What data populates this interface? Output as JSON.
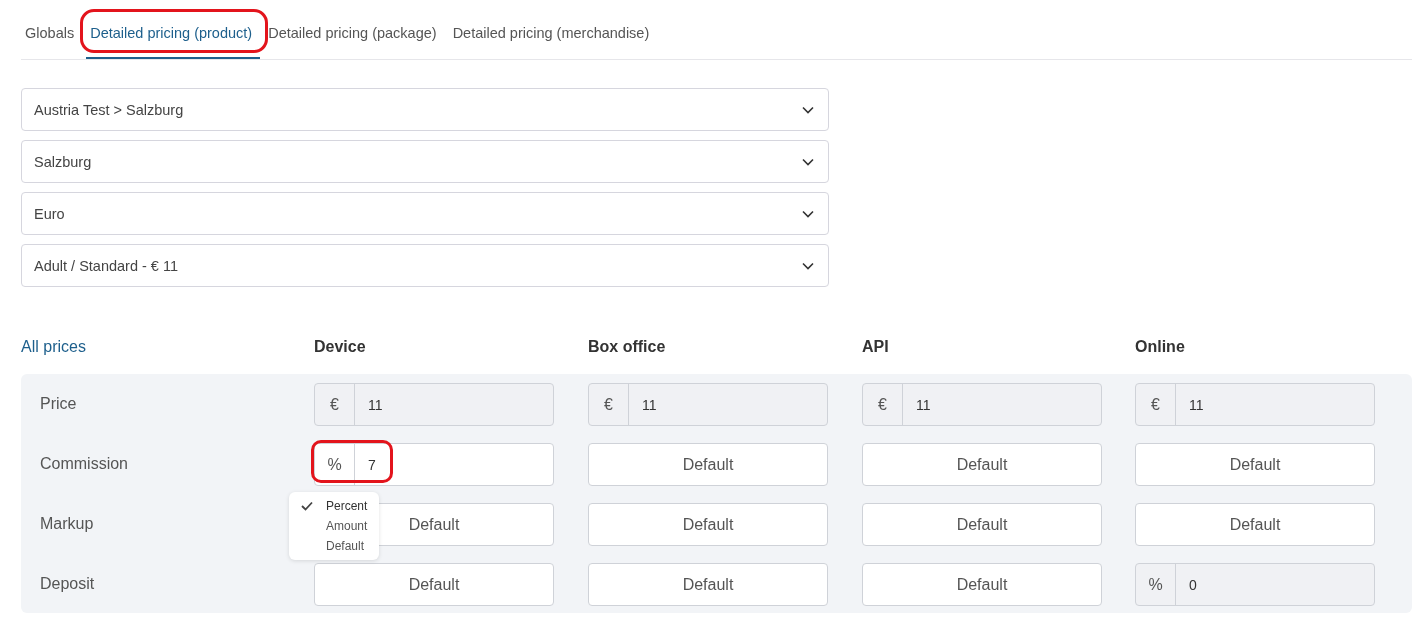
{
  "tabs": [
    {
      "label": "Globals",
      "selected": false,
      "highlighted": false
    },
    {
      "label": "Detailed pricing (product)",
      "selected": true,
      "highlighted": true
    },
    {
      "label": "Detailed pricing (package)",
      "selected": false,
      "highlighted": false
    },
    {
      "label": "Detailed pricing (merchandise)",
      "selected": false,
      "highlighted": false
    }
  ],
  "selects": [
    {
      "value": "Austria Test  > Salzburg"
    },
    {
      "value": "Salzburg"
    },
    {
      "value": "Euro"
    },
    {
      "value": "Adult / Standard - € 11"
    }
  ],
  "table": {
    "link": "All prices",
    "columns": [
      "Device",
      "Box office",
      "API",
      "Online"
    ],
    "rows": [
      {
        "label": "Price",
        "cells": [
          {
            "kind": "unit",
            "unit": "€",
            "value": "11",
            "disabled": true,
            "highlighted": false
          },
          {
            "kind": "unit",
            "unit": "€",
            "value": "11",
            "disabled": true,
            "highlighted": false
          },
          {
            "kind": "unit",
            "unit": "€",
            "value": "11",
            "disabled": true,
            "highlighted": false
          },
          {
            "kind": "unit",
            "unit": "€",
            "value": "11",
            "disabled": true,
            "highlighted": false
          }
        ]
      },
      {
        "label": "Commission",
        "cells": [
          {
            "kind": "unit",
            "unit": "%",
            "value": "7",
            "disabled": false,
            "highlighted": true
          },
          {
            "kind": "default",
            "label": "Default"
          },
          {
            "kind": "default",
            "label": "Default"
          },
          {
            "kind": "default",
            "label": "Default"
          }
        ]
      },
      {
        "label": "Markup",
        "cells": [
          {
            "kind": "default",
            "label": "Default"
          },
          {
            "kind": "default",
            "label": "Default"
          },
          {
            "kind": "default",
            "label": "Default"
          },
          {
            "kind": "default",
            "label": "Default"
          }
        ]
      },
      {
        "label": "Deposit",
        "cells": [
          {
            "kind": "default",
            "label": "Default"
          },
          {
            "kind": "default",
            "label": "Default"
          },
          {
            "kind": "default",
            "label": "Default"
          },
          {
            "kind": "unit",
            "unit": "%",
            "value": "0",
            "disabled": true,
            "highlighted": false
          }
        ]
      }
    ]
  },
  "unit_menu": {
    "items": [
      {
        "label": "Percent",
        "selected": true
      },
      {
        "label": "Amount",
        "selected": false
      },
      {
        "label": "Default",
        "selected": false
      }
    ]
  }
}
